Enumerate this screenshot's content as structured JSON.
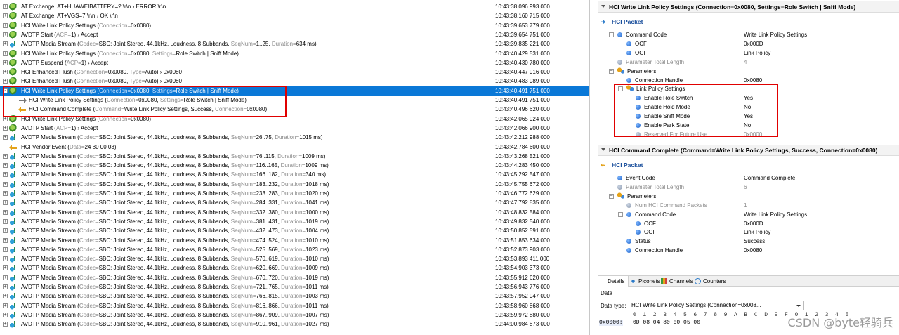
{
  "packets": [
    {
      "expander": "+",
      "icon": "gear-icon",
      "child": false,
      "parts": [
        [
          "AT Exchange: AT+HUAWEIBATTERY=?",
          ""
        ],
        [
          " \\r\\n",
          ""
        ],
        [
          " › ERROR",
          ""
        ],
        [
          " \\r\\n",
          ""
        ]
      ],
      "time": "10:43:38.096 993 000"
    },
    {
      "expander": "+",
      "icon": "gear-icon",
      "child": false,
      "parts": [
        [
          "AT Exchange: AT+VGS=7",
          ""
        ],
        [
          " \\r\\n",
          ""
        ],
        [
          " › OK",
          ""
        ],
        [
          " \\r\\n",
          ""
        ]
      ],
      "time": "10:43:38.160 715 000"
    },
    {
      "expander": "+",
      "icon": "gear-icon",
      "child": false,
      "parts": [
        [
          "HCI Write Link Policy Settings (",
          "Connection=",
          "0x0080",
          ")"
        ]
      ],
      "time": "10:43:39.653 779 000"
    },
    {
      "expander": "+",
      "icon": "gear-icon",
      "child": false,
      "parts": [
        [
          "AVDTP Start (",
          "ACP=",
          "1",
          ") › Accept"
        ]
      ],
      "time": "10:43:39.654 751 000"
    },
    {
      "expander": "+",
      "icon": "music-icon",
      "child": false,
      "parts": [
        [
          "AVDTP Media Stream (",
          "Codec=",
          "SBC: Joint Stereo, 44.1kHz, Loudness, 8 Subbands",
          ", "
        ],
        [
          "",
          "SeqNum=",
          "1..25",
          ", "
        ],
        [
          "",
          "Duration=",
          "634 ms",
          ")"
        ]
      ],
      "time": "10:43:39.835 221 000"
    },
    {
      "expander": "+",
      "icon": "gear-icon",
      "child": false,
      "parts": [
        [
          "HCI Write Link Policy Settings (",
          "Connection=",
          "0x0080",
          ", "
        ],
        [
          "",
          "Settings=",
          "Role Switch | Sniff Mode",
          ")"
        ]
      ],
      "time": "10:43:40.429 531 000"
    },
    {
      "expander": "+",
      "icon": "gear-icon",
      "child": false,
      "parts": [
        [
          "AVDTP Suspend (",
          "ACP=",
          "1",
          ") › Accept"
        ]
      ],
      "time": "10:43:40.430 780 000"
    },
    {
      "expander": "+",
      "icon": "gear-icon",
      "child": false,
      "parts": [
        [
          "HCI Enhanced Flush (",
          "Connection=",
          "0x0080",
          ", "
        ],
        [
          "",
          "Type=",
          "Auto",
          ") › 0x0080"
        ]
      ],
      "time": "10:43:40.447 916 000"
    },
    {
      "expander": "+",
      "icon": "gear-icon",
      "child": false,
      "parts": [
        [
          "HCI Enhanced Flush (",
          "Connection=",
          "0x0080",
          ", "
        ],
        [
          "",
          "Type=",
          "Auto",
          ") › 0x0080"
        ]
      ],
      "time": "10:43:40.483 989 000"
    },
    {
      "expander": "-",
      "icon": "gear-icon",
      "child": false,
      "selected": true,
      "parts": [
        [
          "HCI Write Link Policy Settings (",
          "Connection=",
          "0x0080",
          ", "
        ],
        [
          "",
          "Settings=",
          "Role Switch | Sniff Mode",
          ")"
        ]
      ],
      "time": "10:43:40.491 751 000"
    },
    {
      "expander": "",
      "icon": "arrow-right-icon",
      "child": true,
      "parts": [
        [
          "HCI Write Link Policy Settings (",
          "Connection=",
          "0x0080",
          ", "
        ],
        [
          "",
          "Settings=",
          "Role Switch | Sniff Mode",
          ")"
        ]
      ],
      "time": "10:43:40.491 751 000"
    },
    {
      "expander": "",
      "icon": "event-arrow-icon",
      "child": true,
      "parts": [
        [
          "HCI Command Complete (",
          "Command=",
          "Write Link Policy Settings, Success",
          ", "
        ],
        [
          "",
          "Connection=",
          "0x0080",
          ")"
        ]
      ],
      "time": "10:43:40.496 620 000"
    },
    {
      "expander": "+",
      "icon": "gear-icon",
      "child": false,
      "parts": [
        [
          "HCI Write Link Policy Settings (",
          "Connection=",
          "0x0080",
          ")"
        ]
      ],
      "time": "10:43:42.065 924 000"
    },
    {
      "expander": "+",
      "icon": "gear-icon",
      "child": false,
      "parts": [
        [
          "AVDTP Start (",
          "ACP=",
          "1",
          ") › Accept"
        ]
      ],
      "time": "10:43:42.066 900 000"
    },
    {
      "expander": "+",
      "icon": "music-icon",
      "child": false,
      "parts": [
        [
          "AVDTP Media Stream (",
          "Codec=",
          "SBC: Joint Stereo, 44.1kHz, Loudness, 8 Subbands",
          ", "
        ],
        [
          "",
          "SeqNum=",
          "26..75",
          ", "
        ],
        [
          "",
          "Duration=",
          "1015 ms",
          ")"
        ]
      ],
      "time": "10:43:42.212 988 000"
    },
    {
      "expander": "",
      "icon": "event-arrow-icon",
      "child": false,
      "parts": [
        [
          "HCI Vendor Event (",
          "Data=",
          "24 80 00 03",
          ")"
        ]
      ],
      "time": "10:43:42.784 600 000"
    },
    {
      "expander": "+",
      "icon": "music-icon",
      "child": false,
      "parts": [
        [
          "AVDTP Media Stream (",
          "Codec=",
          "SBC: Joint Stereo, 44.1kHz, Loudness, 8 Subbands",
          ", "
        ],
        [
          "",
          "SeqNum=",
          "76..115",
          ", "
        ],
        [
          "",
          "Duration=",
          "1009 ms",
          ")"
        ]
      ],
      "time": "10:43:43.268 521 000"
    },
    {
      "expander": "+",
      "icon": "music-icon",
      "child": false,
      "parts": [
        [
          "AVDTP Media Stream (",
          "Codec=",
          "SBC: Joint Stereo, 44.1kHz, Loudness, 8 Subbands",
          ", "
        ],
        [
          "",
          "SeqNum=",
          "116..165",
          ", "
        ],
        [
          "",
          "Duration=",
          "1009 ms",
          ")"
        ]
      ],
      "time": "10:43:44.283 450 000"
    },
    {
      "expander": "+",
      "icon": "music-icon",
      "child": false,
      "parts": [
        [
          "AVDTP Media Stream (",
          "Codec=",
          "SBC: Joint Stereo, 44.1kHz, Loudness, 8 Subbands",
          ", "
        ],
        [
          "",
          "SeqNum=",
          "166..182",
          ", "
        ],
        [
          "",
          "Duration=",
          "340 ms",
          ")"
        ]
      ],
      "time": "10:43:45.292 547 000"
    },
    {
      "expander": "+",
      "icon": "music-icon",
      "child": false,
      "parts": [
        [
          "AVDTP Media Stream (",
          "Codec=",
          "SBC: Joint Stereo, 44.1kHz, Loudness, 8 Subbands",
          ", "
        ],
        [
          "",
          "SeqNum=",
          "183..232",
          ", "
        ],
        [
          "",
          "Duration=",
          "1018 ms",
          ")"
        ]
      ],
      "time": "10:43:45.755 672 000"
    },
    {
      "expander": "+",
      "icon": "music-icon",
      "child": false,
      "parts": [
        [
          "AVDTP Media Stream (",
          "Codec=",
          "SBC: Joint Stereo, 44.1kHz, Loudness, 8 Subbands",
          ", "
        ],
        [
          "",
          "SeqNum=",
          "233..283",
          ", "
        ],
        [
          "",
          "Duration=",
          "1020 ms",
          ")"
        ]
      ],
      "time": "10:43:46.772 629 000"
    },
    {
      "expander": "+",
      "icon": "music-icon",
      "child": false,
      "parts": [
        [
          "AVDTP Media Stream (",
          "Codec=",
          "SBC: Joint Stereo, 44.1kHz, Loudness, 8 Subbands",
          ", "
        ],
        [
          "",
          "SeqNum=",
          "284..331",
          ", "
        ],
        [
          "",
          "Duration=",
          "1041 ms",
          ")"
        ]
      ],
      "time": "10:43:47.792 835 000"
    },
    {
      "expander": "+",
      "icon": "music-icon",
      "child": false,
      "parts": [
        [
          "AVDTP Media Stream (",
          "Codec=",
          "SBC: Joint Stereo, 44.1kHz, Loudness, 8 Subbands",
          ", "
        ],
        [
          "",
          "SeqNum=",
          "332..380",
          ", "
        ],
        [
          "",
          "Duration=",
          "1000 ms",
          ")"
        ]
      ],
      "time": "10:43:48.832 584 000"
    },
    {
      "expander": "+",
      "icon": "music-icon",
      "child": false,
      "parts": [
        [
          "AVDTP Media Stream (",
          "Codec=",
          "SBC: Joint Stereo, 44.1kHz, Loudness, 8 Subbands",
          ", "
        ],
        [
          "",
          "SeqNum=",
          "381..431",
          ", "
        ],
        [
          "",
          "Duration=",
          "1019 ms",
          ")"
        ]
      ],
      "time": "10:43:49.832 540 000"
    },
    {
      "expander": "+",
      "icon": "music-icon",
      "child": false,
      "parts": [
        [
          "AVDTP Media Stream (",
          "Codec=",
          "SBC: Joint Stereo, 44.1kHz, Loudness, 8 Subbands",
          ", "
        ],
        [
          "",
          "SeqNum=",
          "432..473",
          ", "
        ],
        [
          "",
          "Duration=",
          "1004 ms",
          ")"
        ]
      ],
      "time": "10:43:50.852 591 000"
    },
    {
      "expander": "+",
      "icon": "music-icon",
      "child": false,
      "parts": [
        [
          "AVDTP Media Stream (",
          "Codec=",
          "SBC: Joint Stereo, 44.1kHz, Loudness, 8 Subbands",
          ", "
        ],
        [
          "",
          "SeqNum=",
          "474..524",
          ", "
        ],
        [
          "",
          "Duration=",
          "1010 ms",
          ")"
        ]
      ],
      "time": "10:43:51.853 634 000"
    },
    {
      "expander": "+",
      "icon": "music-icon",
      "child": false,
      "parts": [
        [
          "AVDTP Media Stream (",
          "Codec=",
          "SBC: Joint Stereo, 44.1kHz, Loudness, 8 Subbands",
          ", "
        ],
        [
          "",
          "SeqNum=",
          "525..569",
          ", "
        ],
        [
          "",
          "Duration=",
          "1023 ms",
          ")"
        ]
      ],
      "time": "10:43:52.873 903 000"
    },
    {
      "expander": "+",
      "icon": "music-icon",
      "child": false,
      "parts": [
        [
          "AVDTP Media Stream (",
          "Codec=",
          "SBC: Joint Stereo, 44.1kHz, Loudness, 8 Subbands",
          ", "
        ],
        [
          "",
          "SeqNum=",
          "570..619",
          ", "
        ],
        [
          "",
          "Duration=",
          "1010 ms",
          ")"
        ]
      ],
      "time": "10:43:53.893 411 000"
    },
    {
      "expander": "+",
      "icon": "music-icon",
      "child": false,
      "parts": [
        [
          "AVDTP Media Stream (",
          "Codec=",
          "SBC: Joint Stereo, 44.1kHz, Loudness, 8 Subbands",
          ", "
        ],
        [
          "",
          "SeqNum=",
          "620..669",
          ", "
        ],
        [
          "",
          "Duration=",
          "1009 ms",
          ")"
        ]
      ],
      "time": "10:43:54.903 373 000"
    },
    {
      "expander": "+",
      "icon": "music-icon",
      "child": false,
      "parts": [
        [
          "AVDTP Media Stream (",
          "Codec=",
          "SBC: Joint Stereo, 44.1kHz, Loudness, 8 Subbands",
          ", "
        ],
        [
          "",
          "SeqNum=",
          "670..720",
          ", "
        ],
        [
          "",
          "Duration=",
          "1019 ms",
          ")"
        ]
      ],
      "time": "10:43:55.912 620 000"
    },
    {
      "expander": "+",
      "icon": "music-icon",
      "child": false,
      "parts": [
        [
          "AVDTP Media Stream (",
          "Codec=",
          "SBC: Joint Stereo, 44.1kHz, Loudness, 8 Subbands",
          ", "
        ],
        [
          "",
          "SeqNum=",
          "721..765",
          ", "
        ],
        [
          "",
          "Duration=",
          "1011 ms",
          ")"
        ]
      ],
      "time": "10:43:56.943 776 000"
    },
    {
      "expander": "+",
      "icon": "music-icon",
      "child": false,
      "parts": [
        [
          "AVDTP Media Stream (",
          "Codec=",
          "SBC: Joint Stereo, 44.1kHz, Loudness, 8 Subbands",
          ", "
        ],
        [
          "",
          "SeqNum=",
          "766..815",
          ", "
        ],
        [
          "",
          "Duration=",
          "1003 ms",
          ")"
        ]
      ],
      "time": "10:43:57.952 947 000"
    },
    {
      "expander": "+",
      "icon": "music-icon",
      "child": false,
      "parts": [
        [
          "AVDTP Media Stream (",
          "Codec=",
          "SBC: Joint Stereo, 44.1kHz, Loudness, 8 Subbands",
          ", "
        ],
        [
          "",
          "SeqNum=",
          "816..866",
          ", "
        ],
        [
          "",
          "Duration=",
          "1011 ms",
          ")"
        ]
      ],
      "time": "10:43:58.960 868 000"
    },
    {
      "expander": "+",
      "icon": "music-icon",
      "child": false,
      "parts": [
        [
          "AVDTP Media Stream (",
          "Codec=",
          "SBC: Joint Stereo, 44.1kHz, Loudness, 8 Subbands",
          ", "
        ],
        [
          "",
          "SeqNum=",
          "867..909",
          ", "
        ],
        [
          "",
          "Duration=",
          "1007 ms",
          ")"
        ]
      ],
      "time": "10:43:59.972 880 000"
    },
    {
      "expander": "+",
      "icon": "music-icon",
      "child": false,
      "parts": [
        [
          "AVDTP Media Stream (",
          "Codec=",
          "SBC: Joint Stereo, 44.1kHz, Loudness, 8 Subbands",
          ", "
        ],
        [
          "",
          "SeqNum=",
          "910..961",
          ", "
        ],
        [
          "",
          "Duration=",
          "1027 ms",
          ")"
        ]
      ],
      "time": "10:44:00.984 873 000"
    }
  ],
  "details": {
    "header1": "HCI Write Link Policy Settings (Connection=0x0080, Settings=Role Switch | Sniff Mode)",
    "packet1": "HCI Packet",
    "tree1": [
      {
        "indent": 0,
        "toggle": "−",
        "icon": "dot",
        "label": "Command Code",
        "value": "Write Link Policy Settings",
        "dim": false
      },
      {
        "indent": 1,
        "toggle": "",
        "icon": "dot",
        "label": "OCF",
        "value": "0x000D",
        "dim": false
      },
      {
        "indent": 1,
        "toggle": "",
        "icon": "dot",
        "label": "OGF",
        "value": "Link Policy",
        "dim": false
      },
      {
        "indent": 0,
        "toggle": "",
        "icon": "dot",
        "label": "Parameter Total Length",
        "value": "4",
        "dim": true
      },
      {
        "indent": 0,
        "toggle": "−",
        "icon": "gears",
        "label": "Parameters",
        "value": "",
        "dim": false
      },
      {
        "indent": 1,
        "toggle": "",
        "icon": "dot",
        "label": "Connection Handle",
        "value": "0x0080",
        "dim": false
      },
      {
        "indent": 1,
        "toggle": "−",
        "icon": "gears",
        "label": "Link Policy Settings",
        "value": "",
        "dim": false
      },
      {
        "indent": 2,
        "toggle": "",
        "icon": "dot",
        "label": "Enable Role Switch",
        "value": "Yes",
        "dim": false
      },
      {
        "indent": 2,
        "toggle": "",
        "icon": "dot",
        "label": "Enable Hold Mode",
        "value": "No",
        "dim": false
      },
      {
        "indent": 2,
        "toggle": "",
        "icon": "dot",
        "label": "Enable Sniff Mode",
        "value": "Yes",
        "dim": false
      },
      {
        "indent": 2,
        "toggle": "",
        "icon": "dot",
        "label": "Enable Park State",
        "value": "No",
        "dim": false
      },
      {
        "indent": 2,
        "toggle": "",
        "icon": "dot",
        "label": "Reserved For Future Use",
        "value": "0x0000",
        "dim": true
      }
    ],
    "header2": "HCI Command Complete (Command=Write Link Policy Settings, Success, Connection=0x0080)",
    "packet2": "HCI Packet",
    "tree2": [
      {
        "indent": 0,
        "toggle": "",
        "icon": "dot",
        "label": "Event Code",
        "value": "Command Complete",
        "dim": false
      },
      {
        "indent": 0,
        "toggle": "",
        "icon": "dot",
        "label": "Parameter Total Length",
        "value": "6",
        "dim": true
      },
      {
        "indent": 0,
        "toggle": "−",
        "icon": "gears",
        "label": "Parameters",
        "value": "",
        "dim": false
      },
      {
        "indent": 1,
        "toggle": "",
        "icon": "dot",
        "label": "Num HCI Command Packets",
        "value": "1",
        "dim": true
      },
      {
        "indent": 1,
        "toggle": "−",
        "icon": "dot",
        "label": "Command Code",
        "value": "Write Link Policy Settings",
        "dim": false
      },
      {
        "indent": 2,
        "toggle": "",
        "icon": "dot",
        "label": "OCF",
        "value": "0x000D",
        "dim": false
      },
      {
        "indent": 2,
        "toggle": "",
        "icon": "dot",
        "label": "OGF",
        "value": "Link Policy",
        "dim": false
      },
      {
        "indent": 1,
        "toggle": "",
        "icon": "dot",
        "label": "Status",
        "value": "Success",
        "dim": false
      },
      {
        "indent": 1,
        "toggle": "",
        "icon": "dot",
        "label": "Connection Handle",
        "value": "0x0080",
        "dim": false
      }
    ]
  },
  "tabs": [
    "Details",
    "Piconets",
    "Channels",
    "Counters"
  ],
  "data_panel": {
    "label": "Data",
    "type_label": "Data type:",
    "type_value": "HCI Write Link Policy Settings (Connection=0x008...",
    "columns": "0  1  2  3  4  5  6  7  8  9  A  B  C  D  E  F  0  1  2  3  4  5",
    "address": "0x0000:",
    "bytes": "0D 08 04 80 00 05 00"
  },
  "watermark": "CSDN @byte轻骑兵"
}
